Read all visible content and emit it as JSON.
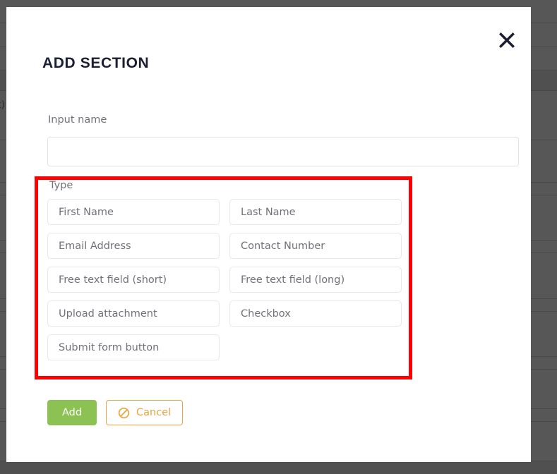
{
  "backdrop": {
    "partial_text": "t)",
    "color": "#575757"
  },
  "modal": {
    "title": "ADD SECTION",
    "close_icon": "close-icon",
    "name_field": {
      "label": "Input name",
      "value": "",
      "placeholder": ""
    },
    "type_field": {
      "label": "Type",
      "options": [
        "First Name",
        "Last Name",
        "Email Address",
        "Contact Number",
        "Free text field (short)",
        "Free text field (long)",
        "Upload attachment",
        "Checkbox",
        "Submit form button"
      ]
    },
    "actions": {
      "add_label": "Add",
      "cancel_label": "Cancel",
      "cancel_icon": "ban-icon"
    }
  },
  "colors": {
    "accent_green": "#8cc153",
    "accent_orange": "#e8a33d",
    "annotation_red": "#fe0000",
    "title_navy": "#1c1f33"
  }
}
